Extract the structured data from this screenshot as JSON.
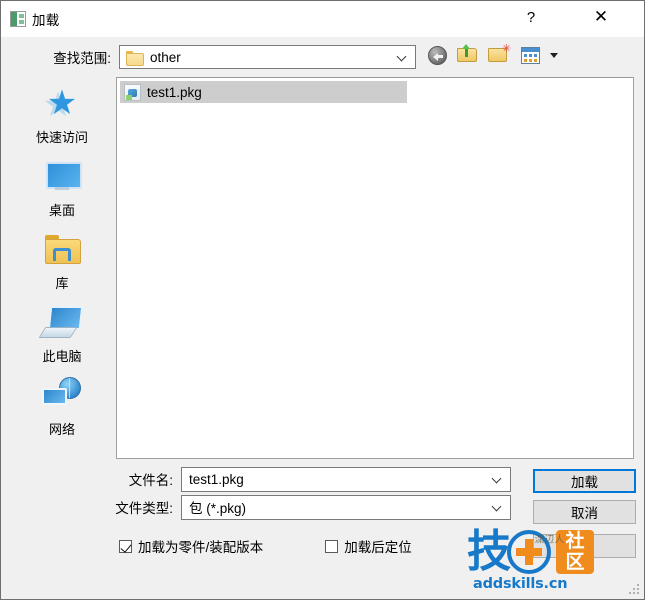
{
  "window": {
    "title": "加载",
    "title_icon": "load-dialog-icon",
    "help_label": "?",
    "close_label": "✕",
    "accent_color": "#0078d7",
    "dialog_bg": "#f0f0f0",
    "pane_bg": "#ffffff"
  },
  "lookin": {
    "label": "查找范围:",
    "value": "other",
    "icon": "folder-icon",
    "dropdown_icon": "chevron-down-icon"
  },
  "toolbar": {
    "back": "back-icon",
    "up": "up-one-level-icon",
    "new_folder": "new-folder-icon",
    "views": "views-icon",
    "views_caret": "chevron-down-icon"
  },
  "sidebar": {
    "items": [
      {
        "label": "快速访问",
        "icon": "quick-access-star-icon"
      },
      {
        "label": "桌面",
        "icon": "desktop-monitor-icon"
      },
      {
        "label": "库",
        "icon": "libraries-folder-icon"
      },
      {
        "label": "此电脑",
        "icon": "this-pc-icon"
      },
      {
        "label": "网络",
        "icon": "network-globe-icon"
      }
    ]
  },
  "file_list": {
    "items": [
      {
        "name": "test1.pkg",
        "icon": "pkg-file-icon",
        "selected": true
      }
    ],
    "selection_color": "#cdcdcd"
  },
  "form": {
    "filename_label": "文件名:",
    "filename_value": "test1.pkg",
    "filetype_label": "文件类型:",
    "filetype_value": "包 (*.pkg)",
    "dropdown_icon": "chevron-down-icon"
  },
  "buttons": {
    "load": "加载",
    "cancel": "取消",
    "third": ""
  },
  "checkboxes": [
    {
      "label": "加载为零件/装配版本",
      "checked": true
    },
    {
      "label": "加载后定位",
      "checked": false
    }
  ],
  "watermark": {
    "logo_text": "技",
    "logo_badge_top": "社",
    "logo_badge_bottom": "区",
    "url": "addskills.cn",
    "stamp": "潇辺人",
    "blue": "#1879c8",
    "orange": "#f08c1e"
  },
  "grip": {
    "icon": "resize-grip-icon"
  }
}
